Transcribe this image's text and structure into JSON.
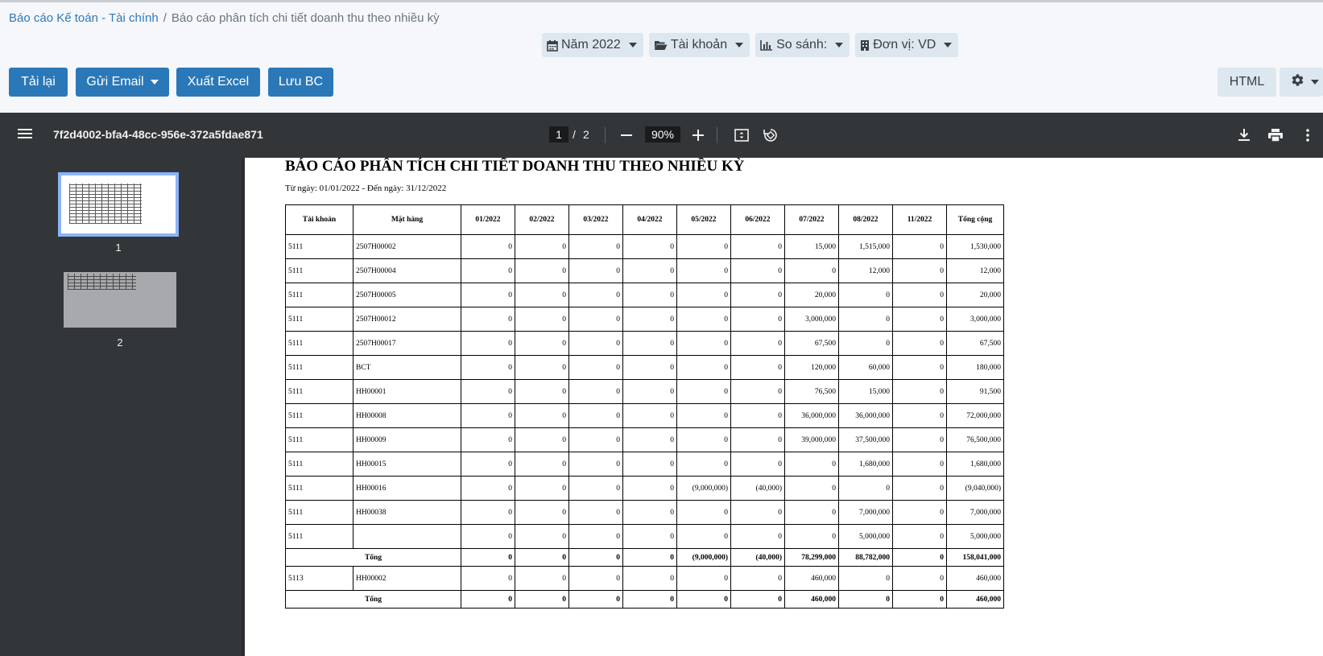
{
  "breadcrumb": {
    "parent": "Báo cáo Kế toán - Tài chính",
    "separator": "/",
    "current": "Báo cáo phân tích chi tiết doanh thu theo nhiều kỳ"
  },
  "filters": {
    "year": "Năm 2022",
    "account": "Tài khoản",
    "compare": "So sánh:",
    "unit": "Đơn vị: VD"
  },
  "actions": {
    "reload": "Tải lại",
    "send_email": "Gửi Email",
    "export_excel": "Xuất Excel",
    "save": "Lưu BC",
    "html": "HTML"
  },
  "pdf_toolbar": {
    "doc_title": "7f2d4002-bfa4-48cc-956e-372a5fdae871",
    "current_page": "1",
    "page_separator": "/",
    "total_pages": "2",
    "zoom": "90%"
  },
  "thumbnails": [
    {
      "label": "1"
    },
    {
      "label": "2"
    }
  ],
  "report": {
    "title": "BÁO CÁO PHÂN TÍCH CHI TIẾT DOANH THU THEO NHIỀU KỲ",
    "subtitle": "Từ ngày: 01/01/2022 - Đến ngày: 31/12/2022",
    "headers": [
      "Tài khoản",
      "Mặt hàng",
      "01/2022",
      "02/2022",
      "03/2022",
      "04/2022",
      "05/2022",
      "06/2022",
      "07/2022",
      "08/2022",
      "11/2022",
      "Tổng cộng"
    ],
    "rows": [
      {
        "type": "data",
        "cells": [
          "5111",
          "2507H00002",
          "0",
          "0",
          "0",
          "0",
          "0",
          "0",
          "15,000",
          "1,515,000",
          "0",
          "1,530,000"
        ]
      },
      {
        "type": "data",
        "cells": [
          "5111",
          "2507H00004",
          "0",
          "0",
          "0",
          "0",
          "0",
          "0",
          "0",
          "12,000",
          "0",
          "12,000"
        ]
      },
      {
        "type": "data",
        "cells": [
          "5111",
          "2507H00005",
          "0",
          "0",
          "0",
          "0",
          "0",
          "0",
          "20,000",
          "0",
          "0",
          "20,000"
        ]
      },
      {
        "type": "data",
        "cells": [
          "5111",
          "2507H00012",
          "0",
          "0",
          "0",
          "0",
          "0",
          "0",
          "3,000,000",
          "0",
          "0",
          "3,000,000"
        ]
      },
      {
        "type": "data",
        "cells": [
          "5111",
          "2507H00017",
          "0",
          "0",
          "0",
          "0",
          "0",
          "0",
          "67,500",
          "0",
          "0",
          "67,500"
        ]
      },
      {
        "type": "data",
        "cells": [
          "5111",
          "BCT",
          "0",
          "0",
          "0",
          "0",
          "0",
          "0",
          "120,000",
          "60,000",
          "0",
          "180,000"
        ]
      },
      {
        "type": "data",
        "cells": [
          "5111",
          "HH00001",
          "0",
          "0",
          "0",
          "0",
          "0",
          "0",
          "76,500",
          "15,000",
          "0",
          "91,500"
        ]
      },
      {
        "type": "data",
        "cells": [
          "5111",
          "HH00008",
          "0",
          "0",
          "0",
          "0",
          "0",
          "0",
          "36,000,000",
          "36,000,000",
          "0",
          "72,000,000"
        ]
      },
      {
        "type": "data",
        "cells": [
          "5111",
          "HH00009",
          "0",
          "0",
          "0",
          "0",
          "0",
          "0",
          "39,000,000",
          "37,500,000",
          "0",
          "76,500,000"
        ]
      },
      {
        "type": "data",
        "cells": [
          "5111",
          "HH00015",
          "0",
          "0",
          "0",
          "0",
          "0",
          "0",
          "0",
          "1,680,000",
          "0",
          "1,680,000"
        ]
      },
      {
        "type": "data",
        "cells": [
          "5111",
          "HH00016",
          "0",
          "0",
          "0",
          "0",
          "(9,000,000)",
          "(40,000)",
          "0",
          "0",
          "0",
          "(9,040,000)"
        ]
      },
      {
        "type": "data",
        "cells": [
          "5111",
          "HH00038",
          "0",
          "0",
          "0",
          "0",
          "0",
          "0",
          "0",
          "7,000,000",
          "0",
          "7,000,000"
        ]
      },
      {
        "type": "data",
        "cells": [
          "5111",
          "",
          "0",
          "0",
          "0",
          "0",
          "0",
          "0",
          "0",
          "5,000,000",
          "0",
          "5,000,000"
        ]
      },
      {
        "type": "total",
        "label": "Tổng",
        "cells": [
          "0",
          "0",
          "0",
          "0",
          "(9,000,000)",
          "(40,000)",
          "78,299,000",
          "88,782,000",
          "0",
          "158,041,000"
        ]
      },
      {
        "type": "data",
        "cells": [
          "5113",
          "HH00002",
          "0",
          "0",
          "0",
          "0",
          "0",
          "0",
          "460,000",
          "0",
          "0",
          "460,000"
        ]
      },
      {
        "type": "total",
        "label": "Tổng",
        "cells": [
          "0",
          "0",
          "0",
          "0",
          "0",
          "0",
          "460,000",
          "0",
          "0",
          "460,000"
        ]
      }
    ]
  }
}
